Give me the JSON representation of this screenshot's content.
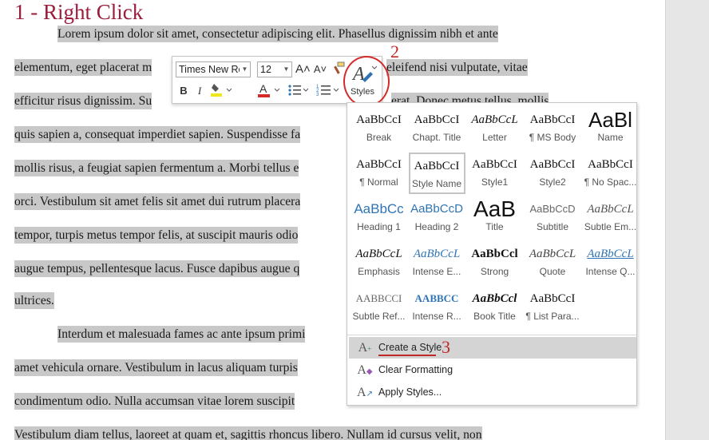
{
  "document": {
    "heading": "1 - Right Click",
    "lines": [
      "Lorem ipsum dolor sit amet, consectetur adipiscing elit. Phasellus dignissim nibh et ante",
      "elementum, eget placerat m",
      "efficitur risus dignissim. Su",
      "quis sapien a, consequat imperdiet sapien. Suspendisse fa",
      "mollis risus, a feugiat sapien fermentum a. Morbi tellus e",
      "orci. Vestibulum sit amet felis sit amet dui rutrum placera",
      "tempor, turpis metus tempor felis, at suscipit mauris odio",
      "augue tempus, pellentesque lacus. Fusce dapibus augue q",
      "ultrices.",
      "Interdum et malesuada fames ac ante ipsum primi",
      "amet vehicula ornare. Vestibulum in lacus aliquam turpis",
      "condimentum odio. Nulla accumsan vitae lorem suscipit",
      "Vestibulum diam tellus, laoreet at quam et, sagittis rhoncus libero. Nullam id cursus velit, non"
    ],
    "line2_tail": "eleifend nisi vulputate, vitae",
    "line3_tail": "erat. Donec metus tellus, mollis"
  },
  "mini_toolbar": {
    "font_name": "Times New Rom",
    "font_size": "12",
    "grow_font": "A˄",
    "shrink_font": "A˅",
    "bold": "B",
    "italic": "I",
    "styles_label": "Styles"
  },
  "annotations": {
    "step2": "2",
    "step3": "3"
  },
  "styles_gallery": {
    "rows": [
      [
        {
          "preview": "AaBbCcI",
          "name": "Break"
        },
        {
          "preview": "AaBbCcI",
          "name": "Chapt. Title"
        },
        {
          "preview": "AaBbCcL",
          "name": "Letter"
        },
        {
          "preview": "AaBbCcI",
          "name": "¶ MS Body"
        },
        {
          "preview": "AaBl",
          "name": "Name"
        }
      ],
      [
        {
          "preview": "AaBbCcI",
          "name": "¶ Normal"
        },
        {
          "preview": "AaBbCcI",
          "name": "Style Name"
        },
        {
          "preview": "AaBbCcI",
          "name": "Style1"
        },
        {
          "preview": "AaBbCcI",
          "name": "Style2"
        },
        {
          "preview": "AaBbCcI",
          "name": "¶ No Spac..."
        }
      ],
      [
        {
          "preview": "AaBbCc",
          "name": "Heading 1"
        },
        {
          "preview": "AaBbCcD",
          "name": "Heading 2"
        },
        {
          "preview": "AaB",
          "name": "Title"
        },
        {
          "preview": "AaBbCcD",
          "name": "Subtitle"
        },
        {
          "preview": "AaBbCcL",
          "name": "Subtle Em..."
        }
      ],
      [
        {
          "preview": "AaBbCcL",
          "name": "Emphasis"
        },
        {
          "preview": "AaBbCcL",
          "name": "Intense E..."
        },
        {
          "preview": "AaBbCcl",
          "name": "Strong"
        },
        {
          "preview": "AaBbCcL",
          "name": "Quote"
        },
        {
          "preview": "AaBbCcL",
          "name": "Intense Q..."
        }
      ],
      [
        {
          "preview": "AABBCCI",
          "name": "Subtle Ref..."
        },
        {
          "preview": "AABBCC",
          "name": "Intense R..."
        },
        {
          "preview": "AaBbCcl",
          "name": "Book Title"
        },
        {
          "preview": "AaBbCcI",
          "name": "¶ List Para..."
        }
      ]
    ],
    "commands": [
      {
        "label": "Create a Style",
        "icon": "A+"
      },
      {
        "label": "Clear Formatting",
        "icon": "A✕"
      },
      {
        "label": "Apply Styles...",
        "icon": "A↗"
      }
    ]
  },
  "colors": {
    "accent_red": "#c02828",
    "highlight": "#c8c8c8",
    "heading": "#9b1c3b",
    "link_blue": "#2e74b5"
  }
}
